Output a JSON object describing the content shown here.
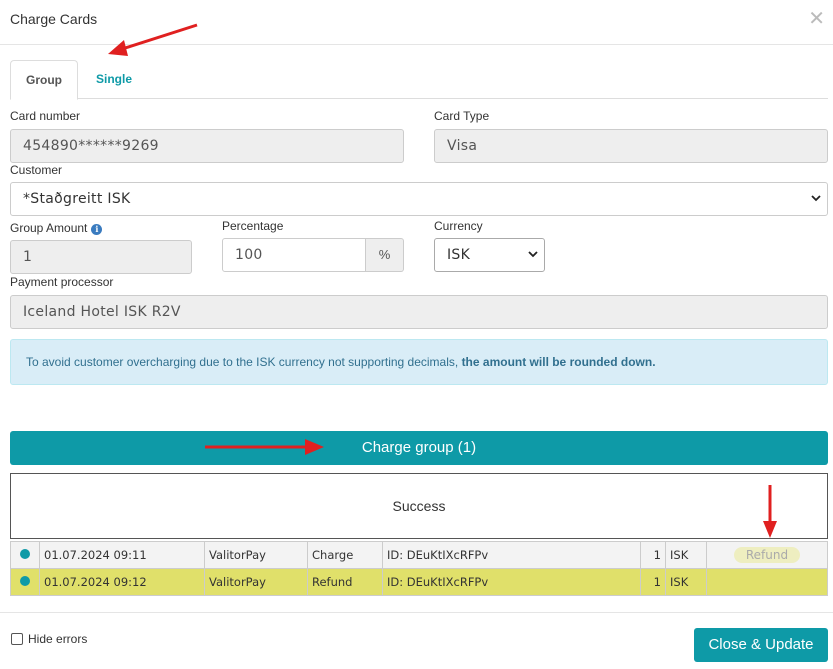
{
  "dialog": {
    "title": "Charge Cards",
    "close_glyph": "✕"
  },
  "tabs": [
    {
      "label": "Group",
      "active": true
    },
    {
      "label": "Single",
      "active": false
    }
  ],
  "form": {
    "card_number": {
      "label": "Card number",
      "value": "454890******9269"
    },
    "card_type": {
      "label": "Card Type",
      "value": "Visa"
    },
    "customer": {
      "label": "Customer",
      "value": "*Staðgreitt ISK"
    },
    "group_amount": {
      "label": "Group Amount",
      "value": "1",
      "info_icon": "info-circle-icon"
    },
    "percentage": {
      "label": "Percentage",
      "value": "100",
      "addon": "%"
    },
    "currency": {
      "label": "Currency",
      "value": "ISK"
    },
    "payment_processor": {
      "label": "Payment processor",
      "value": "Iceland Hotel ISK R2V"
    }
  },
  "alert": {
    "text": "To avoid customer overcharging due to the ISK currency not supporting decimals, ",
    "bold": "the amount will be rounded down."
  },
  "charge_button": "Charge group (1)",
  "result": "Success",
  "transactions": [
    {
      "date": "01.07.2024 09:11",
      "provider": "ValitorPay",
      "type": "Charge",
      "id": "ID: DEuKtIXcRFPv",
      "qty": "1",
      "currency": "ISK",
      "action": "Refund"
    },
    {
      "date": "01.07.2024 09:12",
      "provider": "ValitorPay",
      "type": "Refund",
      "id": "ID: DEuKtIXcRFPv",
      "qty": "1",
      "currency": "ISK",
      "action": ""
    }
  ],
  "footer": {
    "hide_errors": "Hide errors",
    "close_update": "Close & Update"
  },
  "colors": {
    "accent": "#0e9aa7",
    "highlight_row": "#e0e06a",
    "annotation_arrow": "#e02020"
  }
}
